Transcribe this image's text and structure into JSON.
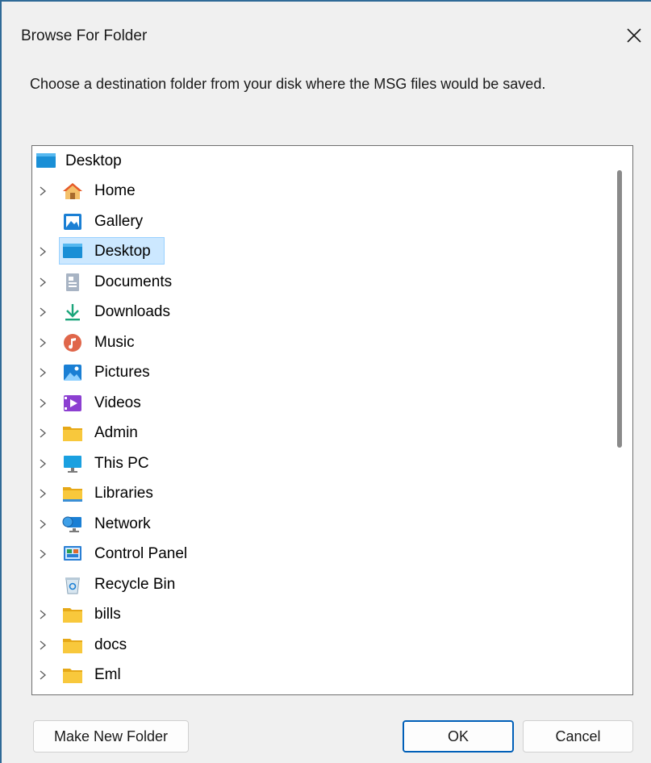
{
  "dialog": {
    "title": "Browse For Folder",
    "instruction": "Choose a destination folder from your disk where the MSG files would be saved."
  },
  "tree": {
    "root": {
      "label": "Desktop",
      "icon": "desktop-icon"
    },
    "items": [
      {
        "label": "Home",
        "icon": "home-icon",
        "expandable": true,
        "selected": false
      },
      {
        "label": "Gallery",
        "icon": "gallery-icon",
        "expandable": false,
        "selected": false
      },
      {
        "label": "Desktop",
        "icon": "desktop-icon",
        "expandable": true,
        "selected": true
      },
      {
        "label": "Documents",
        "icon": "documents-icon",
        "expandable": true,
        "selected": false
      },
      {
        "label": "Downloads",
        "icon": "downloads-icon",
        "expandable": true,
        "selected": false
      },
      {
        "label": "Music",
        "icon": "music-icon",
        "expandable": true,
        "selected": false
      },
      {
        "label": "Pictures",
        "icon": "pictures-icon",
        "expandable": true,
        "selected": false
      },
      {
        "label": "Videos",
        "icon": "videos-icon",
        "expandable": true,
        "selected": false
      },
      {
        "label": "Admin",
        "icon": "folder-icon",
        "expandable": true,
        "selected": false
      },
      {
        "label": "This PC",
        "icon": "this-pc-icon",
        "expandable": true,
        "selected": false
      },
      {
        "label": "Libraries",
        "icon": "libraries-icon",
        "expandable": true,
        "selected": false
      },
      {
        "label": "Network",
        "icon": "network-icon",
        "expandable": true,
        "selected": false
      },
      {
        "label": "Control Panel",
        "icon": "control-panel-icon",
        "expandable": true,
        "selected": false
      },
      {
        "label": "Recycle Bin",
        "icon": "recycle-bin-icon",
        "expandable": false,
        "selected": false
      },
      {
        "label": "bills",
        "icon": "folder-icon",
        "expandable": true,
        "selected": false
      },
      {
        "label": "docs",
        "icon": "folder-icon",
        "expandable": true,
        "selected": false
      },
      {
        "label": "Eml",
        "icon": "folder-icon",
        "expandable": true,
        "selected": false
      }
    ]
  },
  "buttons": {
    "make_new_folder": "Make New Folder",
    "ok": "OK",
    "cancel": "Cancel"
  },
  "colors": {
    "accent": "#005fb8",
    "selection": "#cce8ff",
    "folder": "#f8c83c"
  }
}
